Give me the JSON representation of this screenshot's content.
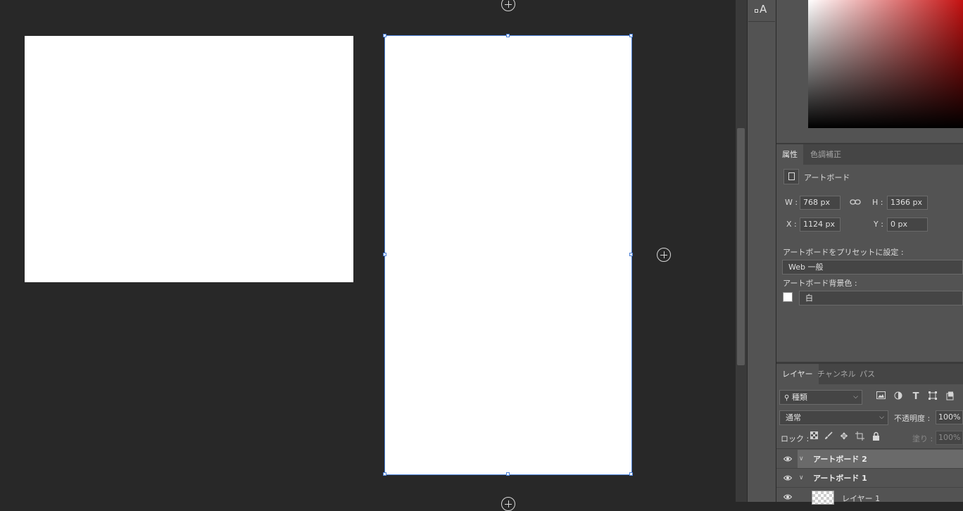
{
  "properties_panel": {
    "tabs": [
      {
        "label": "属性",
        "active": true
      },
      {
        "label": "色調補正",
        "active": false
      }
    ],
    "section_title": "アートボード",
    "w_label": "W :",
    "w_value": "768 px",
    "h_label": "H :",
    "h_value": "1366 px",
    "x_label": "X :",
    "x_value": "1124 px",
    "y_label": "Y :",
    "y_value": "0 px",
    "preset_label": "アートボードをプリセットに設定 :",
    "preset_value": "Web 一般",
    "bg_label": "アートボード背景色 :",
    "bg_value": "白"
  },
  "layers_panel": {
    "tabs": [
      {
        "label": "レイヤー",
        "active": true
      },
      {
        "label": "チャンネル",
        "active": false
      },
      {
        "label": "パス",
        "active": false
      }
    ],
    "filter_value": "種類",
    "blend_mode": "通常",
    "opacity_label": "不透明度 :",
    "opacity_value": "100%",
    "lock_label": "ロック :",
    "fill_label": "塗り :",
    "fill_value": "100%",
    "layers": [
      {
        "name": "アートボード 2",
        "selected": true
      },
      {
        "name": "アートボード 1",
        "selected": false
      },
      {
        "name": "レイヤー 1",
        "selected": false
      }
    ]
  },
  "toolstrip": {
    "glyph_icon_label": "A"
  },
  "colors": {
    "selection": "#4a7fd6",
    "panel_bg": "#535353",
    "canvas_bg": "#282828",
    "picker_hue": "#c41111"
  }
}
